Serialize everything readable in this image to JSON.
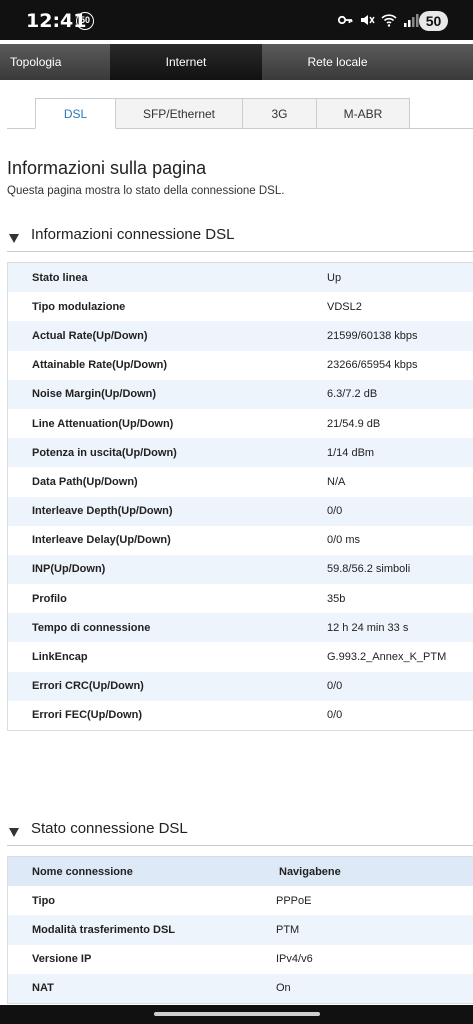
{
  "status_bar": {
    "time": "12:41",
    "notification_badge": "50",
    "battery": "50",
    "icons": [
      "key-icon",
      "mute-icon",
      "wifi-icon",
      "signal-icon"
    ]
  },
  "top_nav": {
    "items": [
      {
        "label": "Topologia"
      },
      {
        "label": "Internet"
      },
      {
        "label": "Rete locale"
      }
    ],
    "active": "Internet"
  },
  "sub_tabs": {
    "items": [
      {
        "label": "DSL"
      },
      {
        "label": "SFP/Ethernet"
      },
      {
        "label": "3G"
      },
      {
        "label": "M-ABR"
      }
    ],
    "active": "DSL"
  },
  "page": {
    "title": "Informazioni sulla pagina",
    "description": "Questa pagina mostra lo stato della connessione DSL."
  },
  "dsl_info": {
    "title": "Informazioni connessione DSL",
    "rows": [
      {
        "key": "Stato linea",
        "value": "Up"
      },
      {
        "key": "Tipo modulazione",
        "value": "VDSL2"
      },
      {
        "key": "Actual Rate(Up/Down)",
        "value": "21599/60138 kbps"
      },
      {
        "key": "Attainable Rate(Up/Down)",
        "value": "23266/65954 kbps"
      },
      {
        "key": "Noise Margin(Up/Down)",
        "value": "6.3/7.2 dB"
      },
      {
        "key": "Line Attenuation(Up/Down)",
        "value": "21/54.9 dB"
      },
      {
        "key": "Potenza in uscita(Up/Down)",
        "value": "1/14 dBm"
      },
      {
        "key": "Data Path(Up/Down)",
        "value": "N/A"
      },
      {
        "key": "Interleave Depth(Up/Down)",
        "value": "0/0"
      },
      {
        "key": "Interleave Delay(Up/Down)",
        "value": "0/0 ms"
      },
      {
        "key": "INP(Up/Down)",
        "value": "59.8/56.2 simboli"
      },
      {
        "key": "Profilo",
        "value": "35b"
      },
      {
        "key": "Tempo di connessione",
        "value": "12 h 24 min 33 s"
      },
      {
        "key": "LinkEncap",
        "value": "G.993.2_Annex_K_PTM"
      },
      {
        "key": "Errori CRC(Up/Down)",
        "value": "0/0"
      },
      {
        "key": "Errori FEC(Up/Down)",
        "value": "0/0"
      }
    ]
  },
  "dsl_status": {
    "title": "Stato connessione DSL",
    "header": {
      "key": "Nome connessione",
      "value": "Navigabene"
    },
    "rows": [
      {
        "key": "Tipo",
        "value": "PPPoE"
      },
      {
        "key": "Modalità trasferimento DSL",
        "value": "PTM"
      },
      {
        "key": "Versione IP",
        "value": "IPv4/v6"
      },
      {
        "key": "NAT",
        "value": "On"
      }
    ]
  }
}
